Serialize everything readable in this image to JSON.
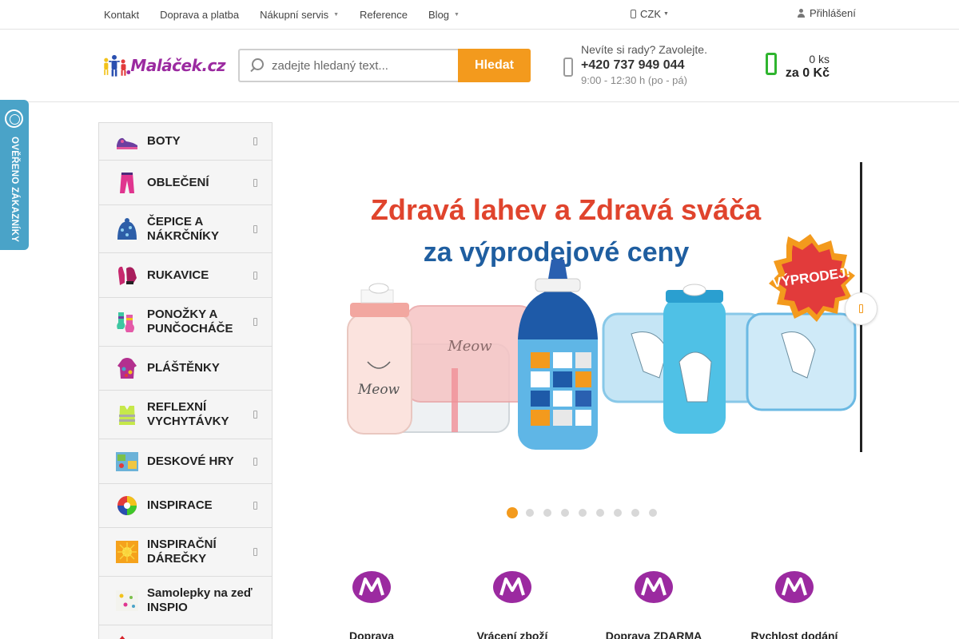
{
  "topbar": {
    "nav": [
      {
        "label": "Kontakt",
        "dropdown": false
      },
      {
        "label": "Doprava a platba",
        "dropdown": false
      },
      {
        "label": "Nákupní servis",
        "dropdown": true
      },
      {
        "label": "Reference",
        "dropdown": false
      },
      {
        "label": "Blog",
        "dropdown": true
      }
    ],
    "currency": "CZK",
    "login": "Přihlášení"
  },
  "header": {
    "logo_text": "Maláček.cz",
    "search_placeholder": "zadejte hledaný text...",
    "search_button": "Hledat",
    "phone_question": "Nevíte si rady? Zavolejte.",
    "phone_number": "+420 737 949 044",
    "phone_hours": "9:00 - 12:30 h (po - pá)",
    "cart_count": "0 ks",
    "cart_total": "za 0 Kč"
  },
  "badge": {
    "verified_text": "OVĚŘENO ZÁKAZNÍKY"
  },
  "sidebar": {
    "categories": [
      {
        "label": "BOTY",
        "has_sub": true
      },
      {
        "label": "OBLEČENÍ",
        "has_sub": true
      },
      {
        "label": "ČEPICE A NÁKRČNÍKY",
        "has_sub": true
      },
      {
        "label": "RUKAVICE",
        "has_sub": true
      },
      {
        "label": "PONOŽKY A PUNČOCHÁČE",
        "has_sub": true
      },
      {
        "label": "PLÁŠTĚNKY",
        "has_sub": false
      },
      {
        "label": "REFLEXNÍ VYCHYTÁVKY",
        "has_sub": true
      },
      {
        "label": "DESKOVÉ HRY",
        "has_sub": true
      },
      {
        "label": "INSPIRACE",
        "has_sub": true
      },
      {
        "label": "INSPIRAČNÍ DÁREČKY",
        "has_sub": true
      },
      {
        "label": "Samolepky na zeď INSPIO",
        "has_sub": false
      }
    ]
  },
  "banner": {
    "headline_1": "Zdravá lahev a Zdravá sváča",
    "headline_2": "za výprodejové ceny",
    "sale_badge": "VÝPRODEJ!",
    "bottle_text": "Meow",
    "slides_total": 9,
    "active_slide": 1
  },
  "benefits": [
    {
      "title": "Doprava"
    },
    {
      "title": "Vrácení zboží"
    },
    {
      "title": "Doprava ZDARMA"
    },
    {
      "title": "Rychlost dodání"
    }
  ],
  "colors": {
    "accent": "#f39a1d",
    "brand": "#9b2aa0",
    "cart": "#2fb52f",
    "badge": "#4aa3c8",
    "headline": "#e0442d",
    "headline_2": "#1f5ea0"
  }
}
